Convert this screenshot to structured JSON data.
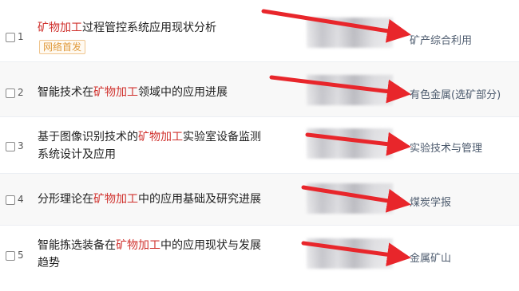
{
  "results": [
    {
      "num": "1",
      "pre": "",
      "hl": "矿物加工",
      "post": "过程管控系统应用现状分析",
      "tag": "网络首发",
      "source": "矿产综合利用"
    },
    {
      "num": "2",
      "pre": "智能技术在",
      "hl": "矿物加工",
      "post": "领域中的应用进展",
      "tag": "",
      "source": "有色金属(选矿部分)"
    },
    {
      "num": "3",
      "pre": "基于图像识别技术的",
      "hl": "矿物加工",
      "post": "实验室设备监测系统设计及应用",
      "tag": "",
      "source": "实验技术与管理"
    },
    {
      "num": "4",
      "pre": "分形理论在",
      "hl": "矿物加工",
      "post": "中的应用基础及研究进展",
      "tag": "",
      "source": "煤炭学报"
    },
    {
      "num": "5",
      "pre": "智能拣选装备在",
      "hl": "矿物加工",
      "post": "中的应用现状与发展趋势",
      "tag": "",
      "source": "金属矿山"
    }
  ],
  "colors": {
    "highlight": "#d0312d",
    "arrow": "#e8262b",
    "tag": "#e09a3c",
    "source": "#4d5b6e"
  }
}
